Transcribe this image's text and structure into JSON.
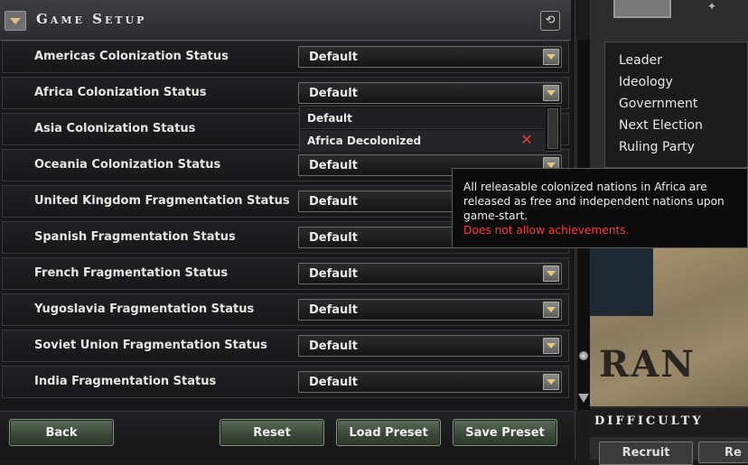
{
  "header": {
    "title": "Game Setup"
  },
  "rows": [
    {
      "label": "Americas Colonization Status",
      "value": "Default"
    },
    {
      "label": "Africa Colonization Status",
      "value": "Default"
    },
    {
      "label": "Asia Colonization Status",
      "value": ""
    },
    {
      "label": "Oceania Colonization Status",
      "value": "Default"
    },
    {
      "label": "United Kingdom Fragmentation Status",
      "value": "Default"
    },
    {
      "label": "Spanish Fragmentation Status",
      "value": "Default"
    },
    {
      "label": "French Fragmentation Status",
      "value": "Default"
    },
    {
      "label": "Yugoslavia Fragmentation Status",
      "value": "Default"
    },
    {
      "label": "Soviet Union Fragmentation Status",
      "value": "Default"
    },
    {
      "label": "India Fragmentation Status",
      "value": "Default"
    }
  ],
  "dropdown_options": [
    "Default",
    "Africa Decolonized"
  ],
  "buttons": {
    "back": "Back",
    "reset": "Reset",
    "load_preset": "Load Preset",
    "save_preset": "Save Preset"
  },
  "info_panel": [
    "Leader",
    "Ideology",
    "Government",
    "Next Election",
    "Ruling Party"
  ],
  "map_label": "RAN",
  "difficulty_label": "Difficulty",
  "recruit_label": "Recruit",
  "recruit_label_2": "Re",
  "tooltip": {
    "text": "All releasable colonized nations in Africa are released as free and independent nations upon game-start.",
    "warning": "Does not allow achievements."
  },
  "colors": {
    "warning": "#ff3b3b",
    "button": "#3c4a3a",
    "arrow": "#f0c472"
  }
}
